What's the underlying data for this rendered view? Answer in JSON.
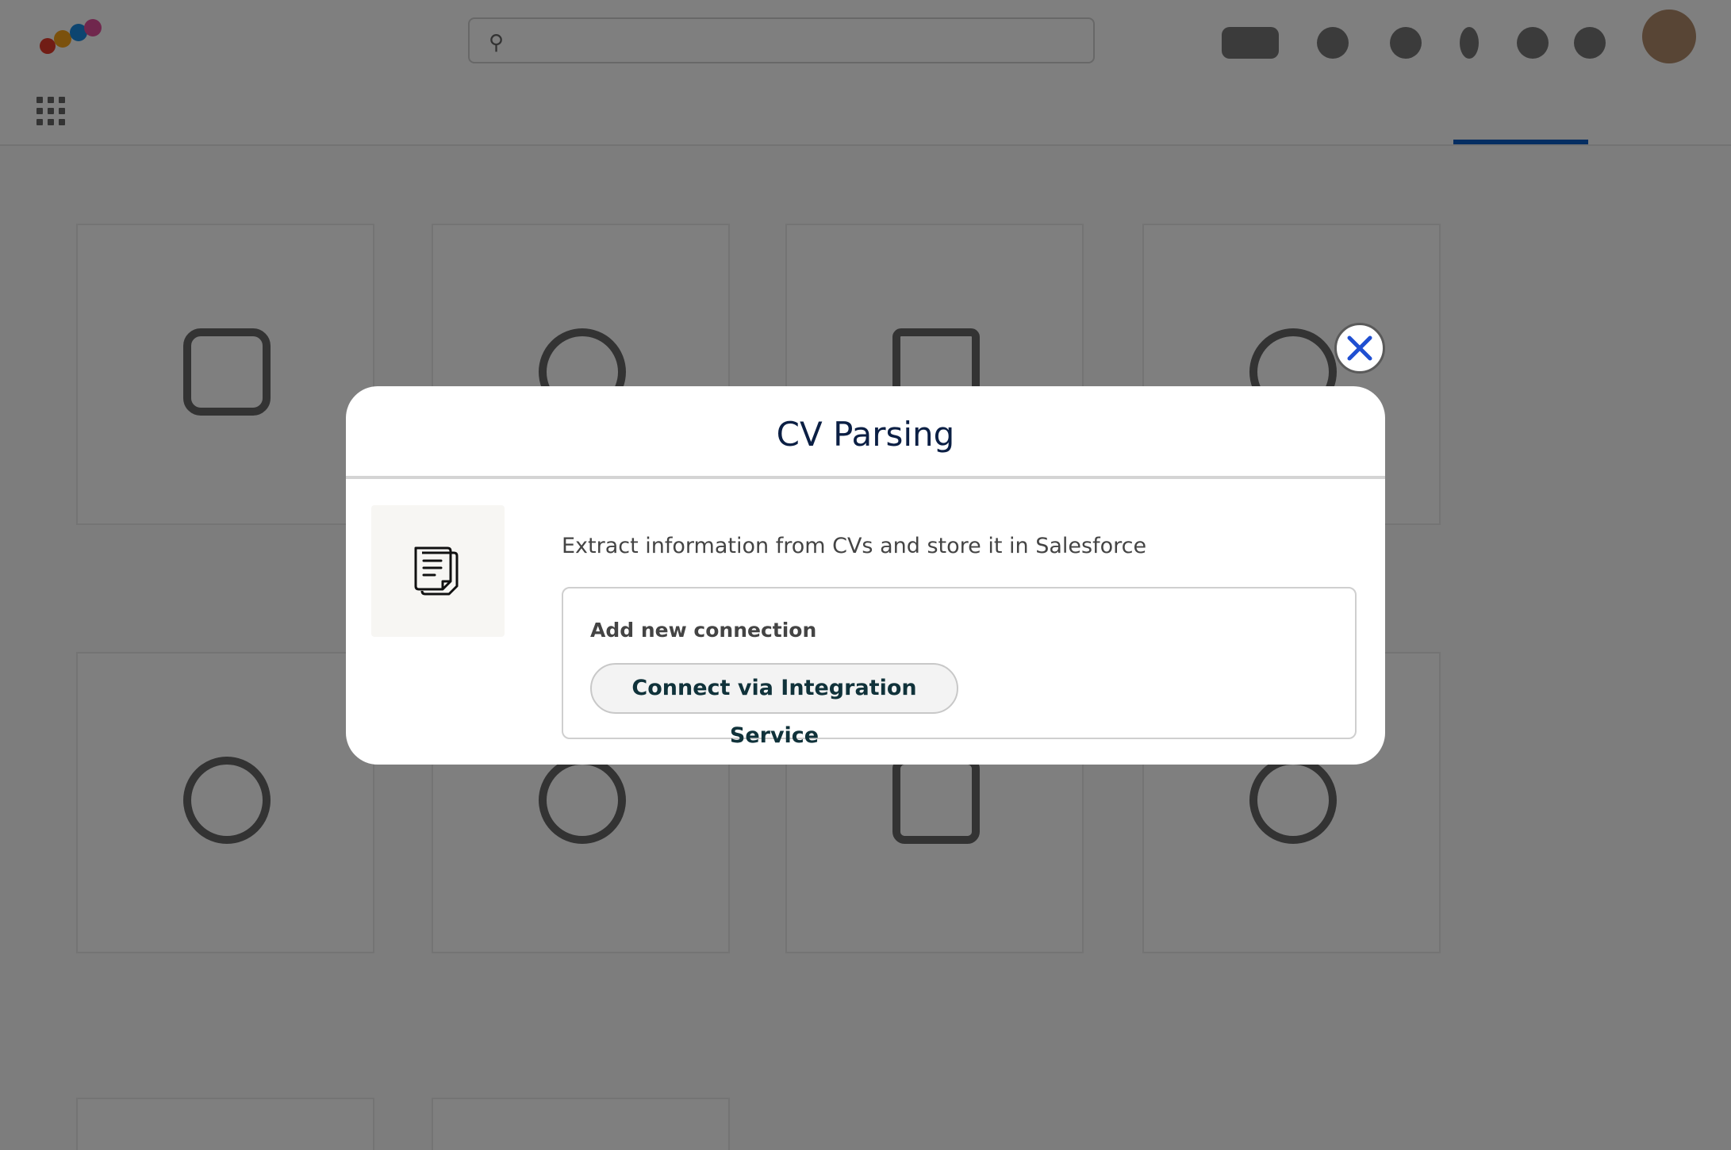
{
  "modal": {
    "title": "CV Parsing",
    "description": "Extract information from CVs and store it in Salesforce",
    "connection_heading": "Add new connection",
    "connect_button_label": "Connect via Integration Service",
    "icon": "document-icon",
    "close_icon": "close-icon"
  },
  "colors": {
    "title": "#0b1f44",
    "close_x": "#1f4fd1",
    "overlay": "rgba(0,0,0,0.5)",
    "active_tab": "#0a5cc4"
  }
}
